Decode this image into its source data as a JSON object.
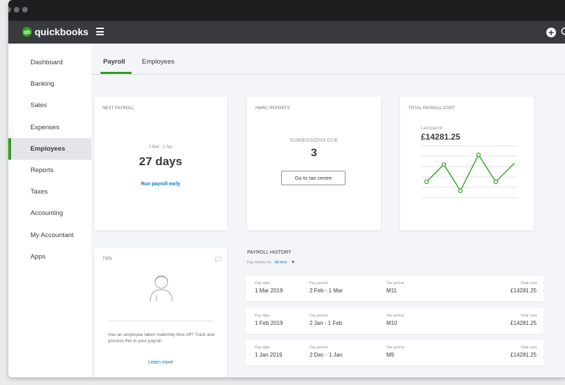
{
  "app": {
    "logo_small": "intuit",
    "logo_text": "quickbooks"
  },
  "sidebar": {
    "items": [
      "Dashboard",
      "Banking",
      "Sales",
      "Expenses",
      "Employees",
      "Reports",
      "Taxes",
      "Accounting",
      "My Accountant",
      "Apps"
    ],
    "active": "Employees"
  },
  "tabs": {
    "payroll": "Payroll",
    "employees": "Employees",
    "active": "Payroll"
  },
  "next_payroll": {
    "title": "NEXT PAYROLL",
    "period": "2 Mar - 1 Apr",
    "days": "27 days",
    "link": "Run payroll early"
  },
  "hmrc": {
    "title": "HMRC REPORTS",
    "label": "SUBMISSIONS DUE",
    "count": "3",
    "button": "Go to tax centre"
  },
  "total_cost": {
    "title": "TOTAL PAYROLL COST",
    "label": "Last payroll",
    "amount": "£14281.25"
  },
  "tips": {
    "title": "TIPS",
    "text": "Has an employee taken maternity time off? Track and process this in your payroll",
    "link": "Learn more"
  },
  "history": {
    "title": "PAYROLL HISTORY",
    "filter_label": "Pay history for",
    "filter_value": "All time",
    "headers": {
      "pay_date": "Pay date",
      "pay_period": "Pay period",
      "tax_period": "Tax period",
      "total_cost": "Total cost"
    },
    "rows": [
      {
        "pay_date": "1 Mar 2019",
        "pay_period": "2 Feb - 1 Mar",
        "tax_period": "M11",
        "total_cost": "£14281.25"
      },
      {
        "pay_date": "1 Feb 2019",
        "pay_period": "2 Jan - 1 Feb",
        "tax_period": "M10",
        "total_cost": "£14281.25"
      },
      {
        "pay_date": "1 Jan 2019",
        "pay_period": "2 Dec - 1 Jan",
        "tax_period": "M9",
        "total_cost": "£14281.25"
      }
    ]
  },
  "colors": {
    "accent": "#2ca01c",
    "link": "#0077c5",
    "appbar": "#393a3d"
  },
  "icons": [
    "hamburger-icon",
    "plus-icon",
    "search-icon",
    "chat-icon",
    "person-icon",
    "dropdown-caret-icon"
  ]
}
